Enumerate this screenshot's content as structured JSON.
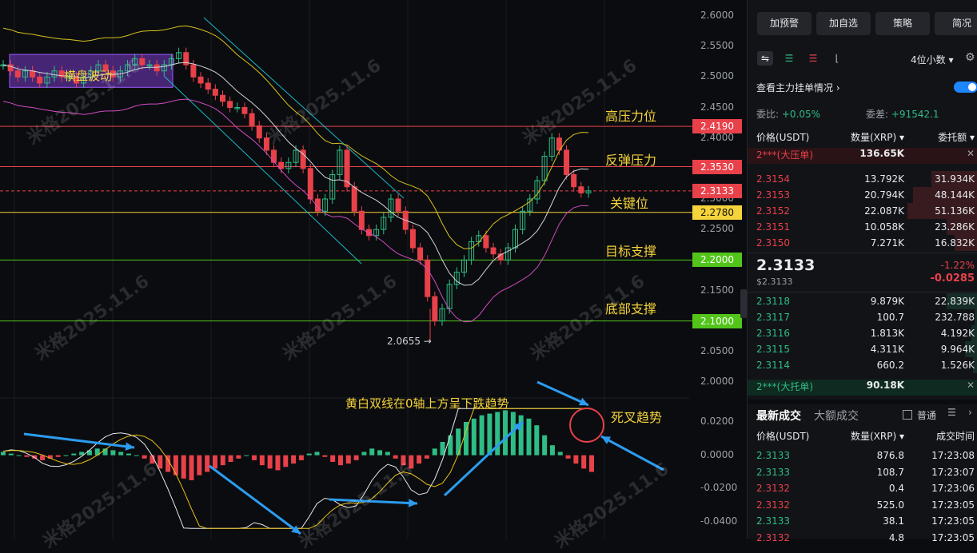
{
  "chart_data": {
    "type": "candlestick",
    "instrument_unit": "XRP/USDT",
    "y_ticks": [
      "2.6000",
      "2.5500",
      "2.5000",
      "2.4500",
      "2.4000",
      "2.3500",
      "2.3000",
      "2.2500",
      "2.2000",
      "2.1500",
      "2.1000",
      "2.0500",
      "2.0000"
    ],
    "y_range": [
      2.0,
      2.6
    ],
    "indicator_ticks": [
      "0.0200",
      "0.0000",
      "-0.0200",
      "-0.0400"
    ],
    "indicator_range": [
      -0.045,
      0.03
    ],
    "horizontal_levels": [
      {
        "value": 2.419,
        "label": "2.4190",
        "color": "#e8414a",
        "note": "高压力位"
      },
      {
        "value": 2.353,
        "label": "2.3530",
        "color": "#e8414a",
        "note": "反弹压力"
      },
      {
        "value": 2.3133,
        "label": "2.3133",
        "color": "#e8414a",
        "note": "关键位"
      },
      {
        "value": 2.278,
        "label": "2.2780",
        "color": "#f5d33a",
        "note": ""
      },
      {
        "value": 2.2,
        "label": "2.2000",
        "color": "#52c41a",
        "note": "目标支撑"
      },
      {
        "value": 2.1,
        "label": "2.1000",
        "color": "#52c41a",
        "note": "底部支撑"
      }
    ],
    "low_marker": {
      "value": 2.0655,
      "label": "2.0655 →"
    },
    "annotations": {
      "range_box": "横盘波动",
      "macd_note": "黄白双线在0轴上方呈下跌趋势",
      "death_cross": "死叉趋势"
    },
    "closes": [
      2.52,
      2.51,
      2.5,
      2.51,
      2.5,
      2.49,
      2.5,
      2.51,
      2.5,
      2.5,
      2.49,
      2.5,
      2.51,
      2.52,
      2.51,
      2.5,
      2.51,
      2.52,
      2.53,
      2.52,
      2.52,
      2.51,
      2.52,
      2.53,
      2.54,
      2.52,
      2.5,
      2.49,
      2.48,
      2.47,
      2.46,
      2.45,
      2.45,
      2.44,
      2.42,
      2.4,
      2.38,
      2.36,
      2.35,
      2.36,
      2.38,
      2.35,
      2.3,
      2.28,
      2.3,
      2.34,
      2.38,
      2.32,
      2.28,
      2.25,
      2.24,
      2.25,
      2.27,
      2.3,
      2.28,
      2.25,
      2.22,
      2.2,
      2.14,
      2.1,
      2.12,
      2.16,
      2.18,
      2.2,
      2.23,
      2.24,
      2.22,
      2.21,
      2.2,
      2.22,
      2.25,
      2.28,
      2.3,
      2.33,
      2.37,
      2.4,
      2.38,
      2.34,
      2.32,
      2.31,
      2.3133
    ],
    "macd_hist": [
      0.002,
      0.001,
      0.0,
      -0.001,
      -0.002,
      -0.003,
      -0.002,
      -0.001,
      0.0,
      0.001,
      0.002,
      0.003,
      0.004,
      0.004,
      0.003,
      0.002,
      0.001,
      0.0,
      -0.002,
      -0.005,
      -0.008,
      -0.01,
      -0.012,
      -0.014,
      -0.015,
      -0.012,
      -0.01,
      -0.008,
      -0.006,
      -0.004,
      -0.002,
      0.0,
      -0.003,
      -0.006,
      -0.008,
      -0.009,
      -0.007,
      -0.005,
      -0.003,
      0.001,
      0.002,
      -0.001,
      -0.004,
      -0.006,
      -0.005,
      -0.003,
      0.002,
      0.004,
      0.003,
      0.002,
      -0.002,
      -0.006,
      -0.008,
      -0.005,
      -0.002,
      0.004,
      0.008,
      0.012,
      0.016,
      0.02,
      0.022,
      0.024,
      0.025,
      0.026,
      0.027,
      0.026,
      0.024,
      0.022,
      0.018,
      0.012,
      0.006,
      0.002,
      -0.002,
      -0.005,
      -0.008,
      -0.01
    ]
  },
  "watermark": "米格2025.11.6",
  "panel": {
    "top_buttons": [
      "加预警",
      "加自选",
      "策略",
      "简况"
    ],
    "decimals": "4位小数",
    "main_orders_label": "查看主力挂单情况",
    "ratio": {
      "label": "委比:",
      "value": "+0.05%"
    },
    "diff": {
      "label": "委差:",
      "value": "+91542.1"
    },
    "headers": {
      "price": "价格(USDT)",
      "qty": "数量(XRP)",
      "total": "委托额"
    },
    "big_ask": {
      "label": "2***(大压单)",
      "qty": "136.65K"
    },
    "asks": [
      {
        "price": "2.3154",
        "qty": "13.792K",
        "total": "31.934K",
        "depth": 0.45
      },
      {
        "price": "2.3153",
        "qty": "20.794K",
        "total": "48.144K",
        "depth": 0.62
      },
      {
        "price": "2.3152",
        "qty": "22.087K",
        "total": "51.136K",
        "depth": 0.68
      },
      {
        "price": "2.3151",
        "qty": "10.058K",
        "total": "23.286K",
        "depth": 0.3
      },
      {
        "price": "2.3150",
        "qty": "7.271K",
        "total": "16.832K",
        "depth": 0.22
      }
    ],
    "last_price": "2.3133",
    "last_price_usd": "$2.3133",
    "change_pct": "-1.22%",
    "change_abs": "-0.0285",
    "bids": [
      {
        "price": "2.3118",
        "qty": "9.879K",
        "total": "22.839K",
        "depth": 0.3
      },
      {
        "price": "2.3117",
        "qty": "100.7",
        "total": "232.788",
        "depth": 0.03
      },
      {
        "price": "2.3116",
        "qty": "1.813K",
        "total": "4.192K",
        "depth": 0.06
      },
      {
        "price": "2.3115",
        "qty": "4.311K",
        "total": "9.964K",
        "depth": 0.12
      },
      {
        "price": "2.3114",
        "qty": "660.2",
        "total": "1.526K",
        "depth": 0.05
      }
    ],
    "big_bid": {
      "label": "2***(大托单)",
      "qty": "90.18K"
    },
    "trade_tabs": [
      "最新成交",
      "大额成交"
    ],
    "normal_label": "普通",
    "trade_headers": {
      "price": "价格(USDT)",
      "qty": "数量(XRP)",
      "time": "成交时间"
    },
    "trades": [
      {
        "price": "2.3133",
        "qty": "876.8",
        "time": "17:23:08",
        "side": "buy"
      },
      {
        "price": "2.3133",
        "qty": "108.7",
        "time": "17:23:07",
        "side": "buy"
      },
      {
        "price": "2.3132",
        "qty": "0.4",
        "time": "17:23:06",
        "side": "sell"
      },
      {
        "price": "2.3132",
        "qty": "525.0",
        "time": "17:23:05",
        "side": "sell"
      },
      {
        "price": "2.3133",
        "qty": "38.1",
        "time": "17:23:05",
        "side": "buy"
      },
      {
        "price": "2.3132",
        "qty": "4.8",
        "time": "17:23:05",
        "side": "sell"
      }
    ]
  }
}
